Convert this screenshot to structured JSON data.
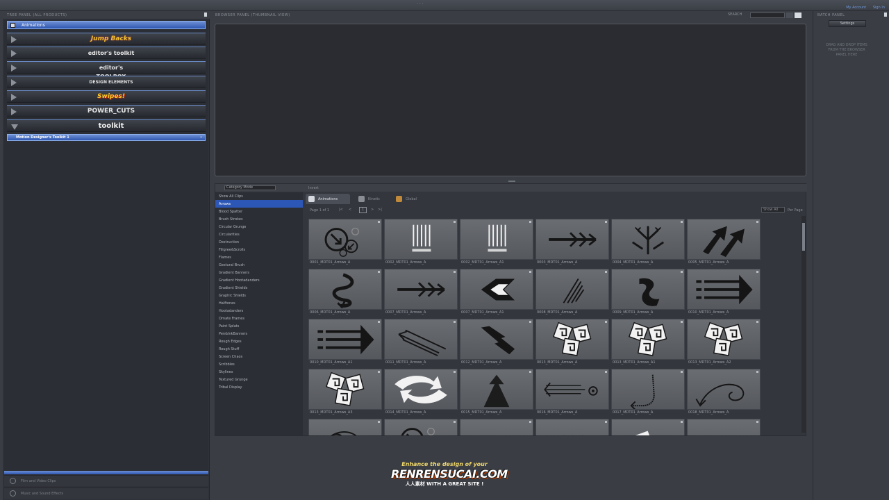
{
  "window": {
    "title": "· · ·",
    "links": [
      "My Account",
      "Sign In"
    ]
  },
  "tree_panel": {
    "header": "TREE PANEL (ALL PRODUCTS)",
    "root_label": "Animations",
    "products": [
      "Jump Backs",
      "editor's toolkit",
      "editor's TOOLBOX",
      "DESIGN ELEMENTS",
      "Swipes!",
      "POWER_CUTS",
      "toolkit"
    ],
    "selected_item": "Motion Designer's Toolkit 1",
    "footer_items": [
      "Film and Video Clips",
      "Music and Sound Effects"
    ]
  },
  "browser_panel": {
    "header": "BROWSER PANEL (THUMBNAIL VIEW)",
    "search_label": "SEARCH"
  },
  "category": {
    "mode": "Category Mode",
    "invert_label": "Invert",
    "items": [
      "Show All Clips",
      "Arrows",
      "Blood Spatter",
      "Brush Strokes",
      "Circular Grunge",
      "Circularities",
      "Destruction",
      "Filigree&Scrolls",
      "Flames",
      "Gestural Brush",
      "Gradient Banners",
      "Gradient Hootadanders",
      "Gradient Shields",
      "Graphic Shields",
      "Halftones",
      "Hootadanders",
      "Ornate Frames",
      "Paint Splats",
      "Pen&InkBanners",
      "Rough Edges",
      "Rough Stuff",
      "Screen Chaos",
      "Scribbles",
      "Skylines",
      "Textured Grunge",
      "Tribal Display"
    ],
    "active": "Arrows"
  },
  "tabs": [
    {
      "label": "Animations",
      "active": true,
      "color": "#d6d9df"
    },
    {
      "label": "Kinetic",
      "active": false,
      "color": "#8a8d93"
    },
    {
      "label": "Global",
      "active": false,
      "color": "#c08a3a"
    }
  ],
  "pager": {
    "page_text": "Page 1 of 1",
    "first": "|<",
    "prev": "<",
    "current": "1",
    "next": ">",
    "last": ">|",
    "show": "Show All",
    "per_page": "Per Page"
  },
  "clips": [
    {
      "name": "0001_MDT01_Arrows_A",
      "icon": "circle-arrows"
    },
    {
      "name": "0002_MDT01_Arrows_A",
      "icon": "vertical-bars"
    },
    {
      "name": "0002_MDT01_Arrows_A1",
      "icon": "vertical-bars"
    },
    {
      "name": "0003_MDT01_Arrows_A",
      "icon": "feather-arrow"
    },
    {
      "name": "0004_MDT01_Arrows_A",
      "icon": "branch-arrows"
    },
    {
      "name": "0005_MDT01_Arrows_A",
      "icon": "double-up-arrows"
    },
    {
      "name": "0006_MDT01_Arrows_A",
      "icon": "spiral-arrow"
    },
    {
      "name": "0007_MDT01_Arrows_A",
      "icon": "feather-arrow"
    },
    {
      "name": "0007_MDT01_Arrows_A1",
      "icon": "chevron-arrow"
    },
    {
      "name": "0008_MDT01_Arrows_A",
      "icon": "brush-arrow"
    },
    {
      "name": "0009_MDT01_Arrows_A",
      "icon": "curved-arrow"
    },
    {
      "name": "0010_MDT01_Arrows_A",
      "icon": "dash-arrows"
    },
    {
      "name": "0010_MDT01_Arrows_A1",
      "icon": "dash-arrows"
    },
    {
      "name": "0011_MDT01_Arrows_A",
      "icon": "diagonal-arrows"
    },
    {
      "name": "0012_MDT01_Arrows_A",
      "icon": "zigzag-arrow"
    },
    {
      "name": "0013_MDT01_Arrows_A",
      "icon": "spiral-squares"
    },
    {
      "name": "0013_MDT01_Arrows_A1",
      "icon": "spiral-squares"
    },
    {
      "name": "0013_MDT01_Arrows_A2",
      "icon": "spiral-squares"
    },
    {
      "name": "0013_MDT01_Arrows_A3",
      "icon": "spiral-squares"
    },
    {
      "name": "0014_MDT01_Arrows_A",
      "icon": "swoosh-arrows"
    },
    {
      "name": "0015_MDT01_Arrows_A",
      "icon": "up-cone-arrow"
    },
    {
      "name": "0016_MDT01_Arrows_A",
      "icon": "line-spiral-arrow"
    },
    {
      "name": "0017_MDT01_Arrows_A",
      "icon": "hook-arrow"
    },
    {
      "name": "0018_MDT01_Arrows_A",
      "icon": "spiral-arrow-2"
    },
    {
      "name": "",
      "icon": "loop"
    },
    {
      "name": "",
      "icon": "circle-arrows"
    },
    {
      "name": "",
      "icon": "triangles"
    },
    {
      "name": "",
      "icon": "chevrons"
    },
    {
      "name": "",
      "icon": "blocks"
    },
    {
      "name": "",
      "icon": "triangles"
    }
  ],
  "batch_panel": {
    "header": "BATCH PANEL",
    "settings_label": "Settings",
    "hint": "DRAG AND DROP ITEMS FROM THE BROWSER PANEL HERE"
  },
  "watermark": {
    "tagline": "Enhance the design of your",
    "brand": "RENRENSUCAI.COM",
    "sub": "人人素材 WITH A GREAT SITE !"
  }
}
